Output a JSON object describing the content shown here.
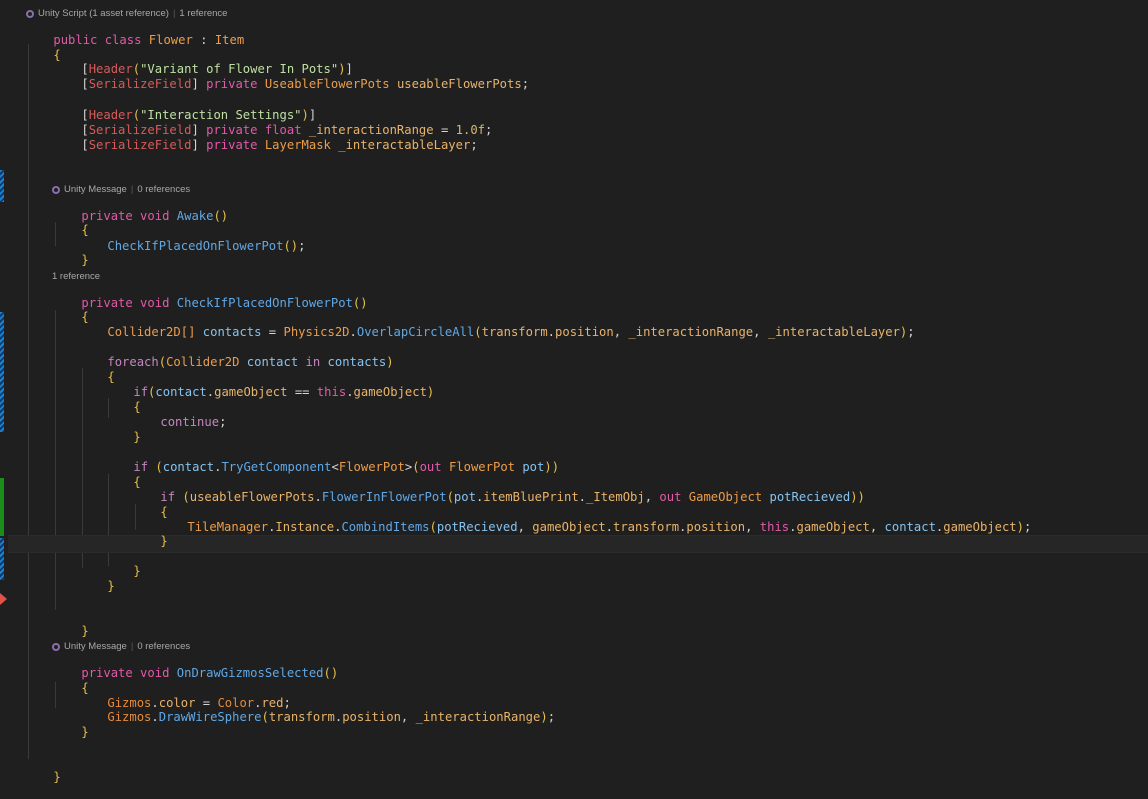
{
  "codelens": {
    "class_lens": {
      "label": "Unity Script (1 asset reference)",
      "refs": "1 reference"
    },
    "awake_lens": {
      "label": "Unity Message",
      "refs": "0 references"
    },
    "check_lens": {
      "refs": "1 reference"
    },
    "gizmos_lens": {
      "label": "Unity Message",
      "refs": "0 references"
    }
  },
  "code": {
    "class_decl": {
      "kw": "public class",
      "name": "Flower",
      "colon": " : ",
      "base": "Item"
    },
    "brace_open": "{",
    "brace_close": "}",
    "header1": {
      "attr": "Header",
      "str": "\"Variant of Flower In Pots\""
    },
    "field1": {
      "attr": "SerializeField",
      "kw": "private",
      "type": "UseableFlowerPots",
      "name": "useableFlowerPots"
    },
    "header2": {
      "attr": "Header",
      "str": "\"Interaction Settings\""
    },
    "field2": {
      "attr": "SerializeField",
      "kw": "private",
      "type": "float",
      "name": "_interactionRange",
      "value": "1.0f"
    },
    "field3": {
      "attr": "SerializeField",
      "kw": "private",
      "type": "LayerMask",
      "name": "_interactableLayer"
    },
    "awake_sig": {
      "kw": "private void",
      "name": "Awake"
    },
    "awake_call": "CheckIfPlacedOnFlowerPot",
    "check_sig": {
      "kw": "private void",
      "name": "CheckIfPlacedOnFlowerPot"
    },
    "contacts_line": {
      "type": "Collider2D[]",
      "var": "contacts",
      "cls": "Physics2D",
      "method": "OverlapCircleAll",
      "a1": "transform",
      "a1b": "position",
      "a2": "_interactionRange",
      "a3": "_interactableLayer"
    },
    "foreach_line": {
      "kw": "foreach",
      "type": "Collider2D",
      "var": "contact",
      "in": "in",
      "coll": "contacts"
    },
    "if1": {
      "kw": "if",
      "var": "contact",
      "prop": "gameObject",
      "op": " == ",
      "this": "this",
      "prop2": "gameObject"
    },
    "continue": "continue",
    "if2": {
      "kw": "if",
      "var": "contact",
      "method": "TryGetComponent",
      "generic": "FlowerPot",
      "out": "out",
      "type": "FlowerPot",
      "name": "pot"
    },
    "if3": {
      "kw": "if",
      "field": "useableFlowerPots",
      "method": "FlowerInFlowerPot",
      "p1": "pot",
      "p2": "itemBluePrint",
      "p3": "_ItemObj",
      "out": "out",
      "type": "GameObject",
      "name": "potRecieved"
    },
    "combine_line": {
      "cls": "TileManager",
      "inst": "Instance",
      "method": "CombindItems",
      "a1": "potRecieved",
      "a2": "gameObject",
      "a2b": "transform",
      "a2c": "position",
      "this": "this",
      "a3": "gameObject",
      "a4": "contact",
      "a4b": "gameObject"
    },
    "gizmos_sig": {
      "kw": "private void",
      "name": "OnDrawGizmosSelected"
    },
    "gizmos_color": {
      "cls": "Gizmos",
      "prop": "color",
      "cls2": "Color",
      "val": "red"
    },
    "gizmos_draw": {
      "cls": "Gizmos",
      "method": "DrawWireSphere",
      "a1": "transform",
      "a1b": "position",
      "a2": "_interactionRange"
    }
  },
  "colors": {
    "background": "#1f1f1f",
    "keyword": "#e25aa8",
    "type": "#ec9d4b",
    "method": "#60a8e6",
    "string": "#bfe0a3",
    "change_bar_modified": "#1b81d6",
    "change_bar_added": "#1a8d1a",
    "change_bar_deleted": "#e0524a"
  }
}
